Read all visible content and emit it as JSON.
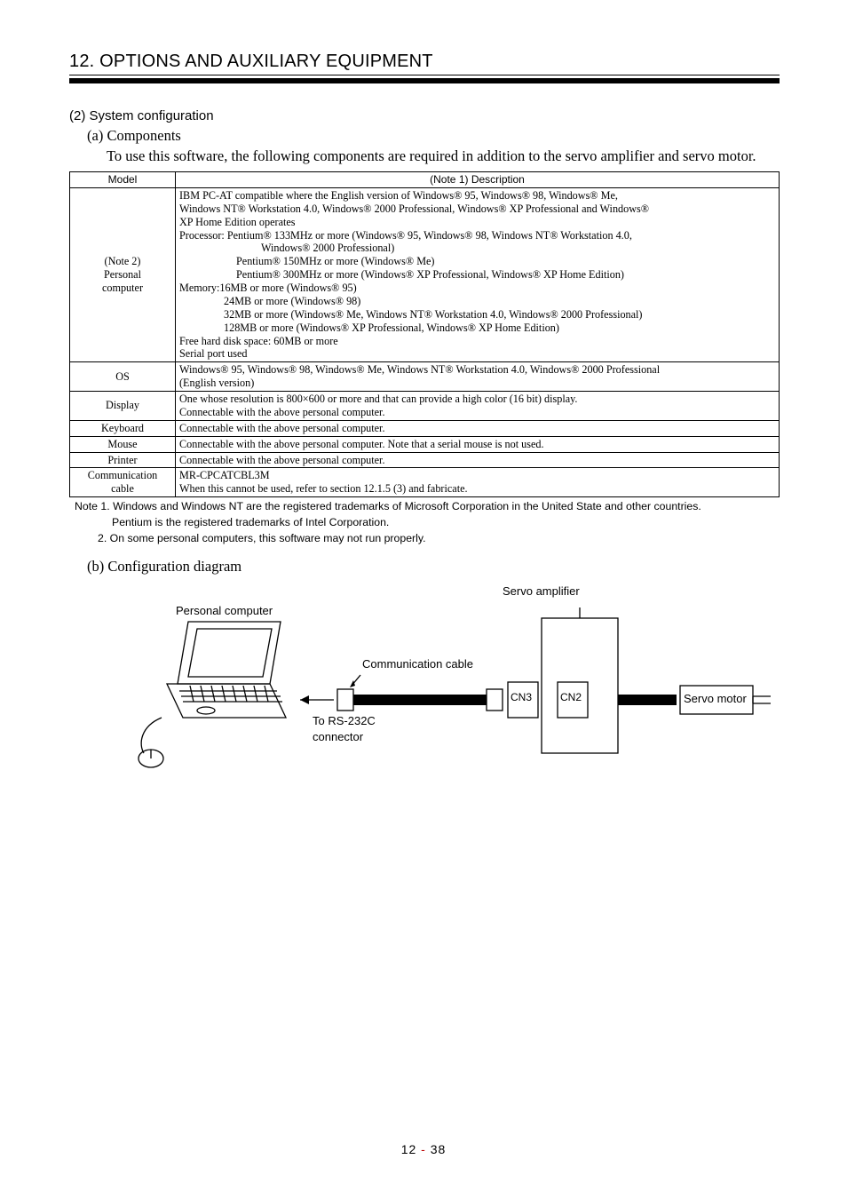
{
  "section_title": "12. OPTIONS AND AUXILIARY EQUIPMENT",
  "para_num": "(2) System configuration",
  "sub_a": "(a) Components",
  "intro": "To use this software, the following components are required in addition to the servo amplifier and servo motor.",
  "table": {
    "head": {
      "model": "Model",
      "desc": "(Note 1) Description"
    },
    "rows": {
      "pc": {
        "model_l1": "(Note 2)",
        "model_l2": "Personal",
        "model_l3": "computer",
        "l1": "IBM PC-AT compatible where the English version of Windows® 95, Windows® 98, Windows® Me,",
        "l2": "Windows NT® Workstation 4.0, Windows® 2000 Professional, Windows® XP Professional and Windows®",
        "l3": "XP Home Edition operates",
        "l4a": "Processor:",
        "l4b": "Pentium® 133MHz or more (Windows® 95, Windows® 98, Windows NT® Workstation 4.0,",
        "l5": "Windows® 2000 Professional)",
        "l6": "Pentium® 150MHz or more (Windows® Me)",
        "l7": "Pentium® 300MHz or more (Windows® XP Professional, Windows® XP Home Edition)",
        "l8a": "Memory:",
        "l8b": "16MB or more (Windows® 95)",
        "l9": "24MB or more (Windows® 98)",
        "l10": "32MB or more (Windows® Me, Windows NT® Workstation 4.0, Windows® 2000 Professional)",
        "l11": "128MB or more (Windows® XP Professional, Windows® XP Home Edition)",
        "l12": "Free hard disk space: 60MB or more",
        "l13": "Serial port used"
      },
      "os": {
        "model": "OS",
        "l1": "Windows® 95, Windows® 98, Windows® Me, Windows NT® Workstation 4.0, Windows® 2000 Professional",
        "l2": "(English version)"
      },
      "display": {
        "model": "Display",
        "l1": "One whose resolution is 800×600 or more and that can provide a high color (16 bit) display.",
        "l2": "Connectable with the above personal computer."
      },
      "keyboard": {
        "model": "Keyboard",
        "desc": "Connectable with the above personal computer."
      },
      "mouse": {
        "model": "Mouse",
        "desc": "Connectable with the above personal computer. Note that a serial mouse is not used."
      },
      "printer": {
        "model": "Printer",
        "desc": "Connectable with the above personal computer."
      },
      "cable": {
        "model_l1": "Communication",
        "model_l2": "cable",
        "l1": "MR-CPCATCBL3M",
        "l2": "When this cannot be used, refer to section 12.1.5 (3) and fabricate."
      }
    }
  },
  "notes": {
    "n1a": "Note 1. Windows and Windows NT are the registered trademarks of Microsoft Corporation in the United State and other countries.",
    "n1b": "Pentium is the registered trademarks of Intel Corporation.",
    "n2": "2. On some personal computers, this software may not run properly."
  },
  "sub_b": "(b) Configuration diagram",
  "diagram": {
    "servo_amp": "Servo amplifier",
    "pc": "Personal computer",
    "cable": "Communication cable",
    "to_rs": "To RS-232C",
    "conn": "connector",
    "cn3": "CN3",
    "cn2": "CN2",
    "servo_motor": "Servo motor"
  },
  "page": {
    "section": "12",
    "dash": " -  ",
    "num": "38"
  }
}
